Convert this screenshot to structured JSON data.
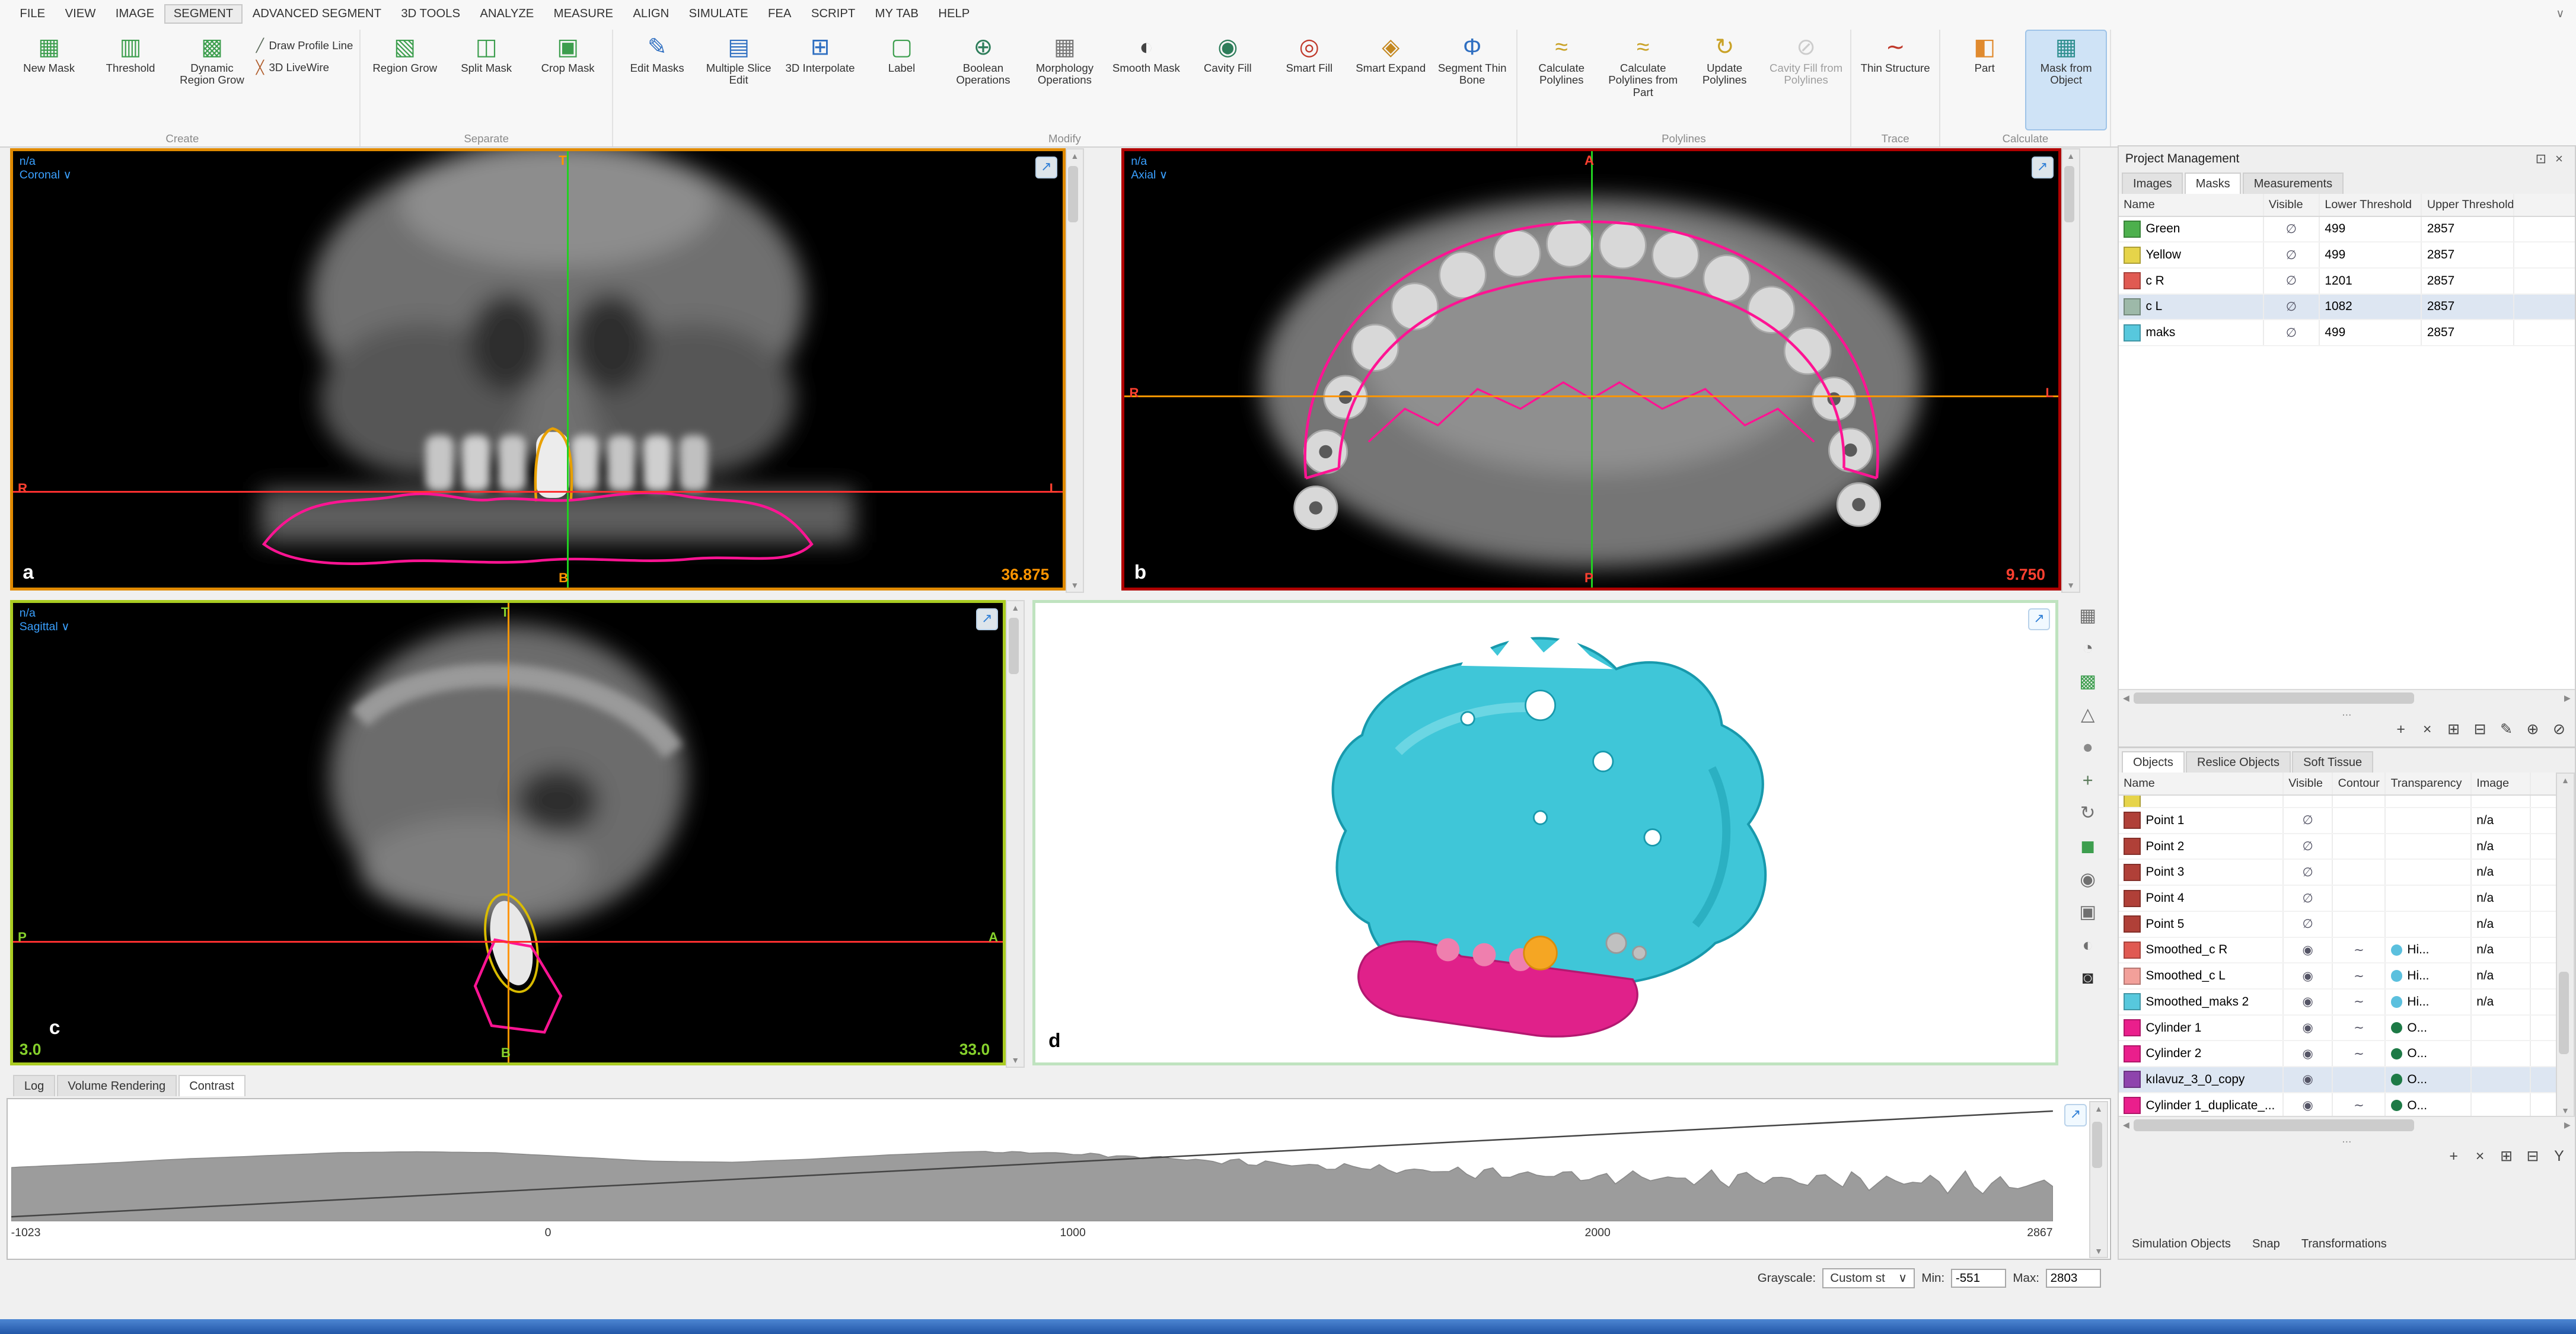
{
  "glyphs": {
    "up": "▲",
    "down": "▼",
    "left": "◀",
    "right": "▶",
    "expand": "↗",
    "caret": "∨",
    "dots": "...",
    "close": "×",
    "float": "⊡",
    "eye": "◉",
    "menu_caret": "∨"
  },
  "menu": {
    "items": [
      "FILE",
      "VIEW",
      "IMAGE",
      "SEGMENT",
      "ADVANCED SEGMENT",
      "3D TOOLS",
      "ANALYZE",
      "MEASURE",
      "ALIGN",
      "SIMULATE",
      "FEA",
      "SCRIPT",
      "MY TAB",
      "HELP"
    ],
    "active": "SEGMENT"
  },
  "ribbon": {
    "groups": [
      {
        "label": "Create",
        "buttons": [
          {
            "label": "New Mask",
            "icon": "new-mask-icon",
            "glyph": "▦",
            "color": "#3d9e4e"
          },
          {
            "label": "Threshold",
            "icon": "threshold-icon",
            "glyph": "▥",
            "color": "#3d9e4e"
          },
          {
            "label": "Dynamic Region Grow",
            "icon": "dynamic-region-grow-icon",
            "glyph": "▩",
            "color": "#3d9e4e"
          }
        ],
        "stack": [
          {
            "label": "Draw Profile Line",
            "icon": "draw-profile-line-icon",
            "glyph": "╱",
            "color": "#5a6a5a"
          },
          {
            "label": "3D LiveWire",
            "icon": "3d-livewire-icon",
            "glyph": "╳",
            "color": "#b05c2a"
          }
        ]
      },
      {
        "label": "Separate",
        "buttons": [
          {
            "label": "Region Grow",
            "icon": "region-grow-icon",
            "glyph": "▧",
            "color": "#3d9e4e"
          },
          {
            "label": "Split Mask",
            "icon": "split-mask-icon",
            "glyph": "◫",
            "color": "#3d9e4e"
          },
          {
            "label": "Crop Mask",
            "icon": "crop-mask-icon",
            "glyph": "▣",
            "color": "#3d9e4e"
          }
        ]
      },
      {
        "label": "Modify",
        "buttons": [
          {
            "label": "Edit Masks",
            "icon": "edit-masks-icon",
            "glyph": "✎",
            "color": "#2f6fc1"
          },
          {
            "label": "Multiple Slice Edit",
            "icon": "multiple-slice-edit-icon",
            "glyph": "▤",
            "color": "#2f6fc1"
          },
          {
            "label": "3D Interpolate",
            "icon": "3d-interpolate-icon",
            "glyph": "⊞",
            "color": "#2f6fc1"
          },
          {
            "label": "Label",
            "icon": "label-icon",
            "glyph": "▢",
            "color": "#3d9e4e"
          },
          {
            "label": "Boolean Operations",
            "icon": "boolean-operations-icon",
            "glyph": "⊕",
            "color": "#2d7d5a"
          },
          {
            "label": "Morphology Operations",
            "icon": "morphology-operations-icon",
            "glyph": "▦",
            "color": "#777777"
          },
          {
            "label": "Smooth Mask",
            "icon": "smooth-mask-icon",
            "glyph": "◐",
            "color": "#444444"
          },
          {
            "label": "Cavity Fill",
            "icon": "cavity-fill-icon",
            "glyph": "◉",
            "color": "#2d7d5a"
          },
          {
            "label": "Smart Fill",
            "icon": "smart-fill-icon",
            "glyph": "◎",
            "color": "#c0392b"
          },
          {
            "label": "Smart Expand",
            "icon": "smart-expand-icon",
            "glyph": "◈",
            "color": "#c48820"
          },
          {
            "label": "Segment Thin Bone",
            "icon": "segment-thin-bone-icon",
            "glyph": "Φ",
            "color": "#2f6fc1"
          }
        ]
      },
      {
        "label": "Polylines",
        "buttons": [
          {
            "label": "Calculate Polylines",
            "icon": "calculate-polylines-icon",
            "glyph": "≈",
            "color": "#c9a227"
          },
          {
            "label": "Calculate Polylines from Part",
            "icon": "calculate-polylines-from-part-icon",
            "glyph": "≈",
            "color": "#c9a227"
          },
          {
            "label": "Update Polylines",
            "icon": "update-polylines-icon",
            "glyph": "↻",
            "color": "#c9a227"
          },
          {
            "label": "Cavity Fill from Polylines",
            "icon": "cavity-fill-from-polylines-icon",
            "glyph": "⊘",
            "color": "#9a9a9a",
            "disabled": true
          }
        ]
      },
      {
        "label": "Trace",
        "buttons": [
          {
            "label": "Thin Structure",
            "icon": "thin-structure-icon",
            "glyph": "∼",
            "color": "#c0392b"
          }
        ]
      },
      {
        "label": "Calculate",
        "buttons": [
          {
            "label": "Part",
            "icon": "part-icon",
            "glyph": "◧",
            "color": "#e08a2e"
          },
          {
            "label": "Mask from Object",
            "icon": "mask-from-object-icon",
            "glyph": "▦",
            "color": "#2f8f8f",
            "selected": true
          }
        ]
      }
    ]
  },
  "side_toolbar": {
    "icons": [
      {
        "name": "layout-grid-icon",
        "glyph": "▦",
        "color": "#707070"
      },
      {
        "name": "zoom-view-icon",
        "glyph": "◔",
        "color": "#707070"
      },
      {
        "name": "mask-overlay-icon",
        "glyph": "▩",
        "color": "#3d9e4e"
      },
      {
        "name": "annotation-icon",
        "glyph": "△",
        "color": "#707070"
      },
      {
        "name": "sphere-tool-icon",
        "glyph": "●",
        "color": "#8a8a8a"
      },
      {
        "name": "pan-tool-icon",
        "glyph": "+",
        "color": "#5a7a5a"
      },
      {
        "name": "rotate-tool-icon",
        "glyph": "↻",
        "color": "#707070"
      },
      {
        "name": "cube-view-icon",
        "glyph": "◼",
        "color": "#3d9e4e"
      },
      {
        "name": "visibility-icon",
        "glyph": "◉",
        "color": "#707070"
      },
      {
        "name": "camera-icon",
        "glyph": "▣",
        "color": "#707070"
      },
      {
        "name": "contrast-icon",
        "glyph": "◐",
        "color": "#707070"
      },
      {
        "name": "screenshot-icon",
        "glyph": "◙",
        "color": "#303030"
      }
    ]
  },
  "viewports": {
    "a": {
      "na_label": "n/a",
      "view_label": "Coronal",
      "letter": "a",
      "slice_value": "36.875",
      "orient": {
        "top": "T",
        "bottom": "B",
        "left": "R",
        "right": "L"
      }
    },
    "b": {
      "na_label": "n/a",
      "view_label": "Axial",
      "letter": "b",
      "slice_value": "9.750",
      "orient": {
        "top": "A",
        "bottom": "P",
        "left": "R",
        "right": "L"
      }
    },
    "c": {
      "na_label": "n/a",
      "view_label": "Sagittal",
      "letter": "c",
      "slice_value_left": "3.0",
      "slice_value_right": "33.0",
      "orient": {
        "top": "T",
        "bottom": "B",
        "left": "P",
        "right": "A"
      }
    },
    "d": {
      "letter": "d"
    }
  },
  "project_panel": {
    "title": "Project Management",
    "tabs": [
      "Images",
      "Masks",
      "Measurements"
    ],
    "active_tab": "Masks",
    "columns": [
      "Name",
      "Visible",
      "Lower Threshold",
      "Upper Threshold"
    ],
    "rows": [
      {
        "name": "Green",
        "color": "#4db04d",
        "visible": "∅",
        "lower": "499",
        "upper": "2857"
      },
      {
        "name": "Yellow",
        "color": "#e6d44a",
        "visible": "∅",
        "lower": "499",
        "upper": "2857"
      },
      {
        "name": "c R",
        "color": "#e05a52",
        "visible": "∅",
        "lower": "1201",
        "upper": "2857"
      },
      {
        "name": "c L",
        "color": "#9db9a9",
        "visible": "∅",
        "lower": "1082",
        "upper": "2857",
        "selected": true
      },
      {
        "name": "maks",
        "color": "#57c8dd",
        "visible": "∅",
        "lower": "499",
        "upper": "2857"
      }
    ],
    "toolbar": [
      {
        "name": "add-mask-button",
        "glyph": "+"
      },
      {
        "name": "delete-mask-button",
        "glyph": "×"
      },
      {
        "name": "mask-properties-button",
        "glyph": "⊞"
      },
      {
        "name": "duplicate-mask-button",
        "glyph": "⊟"
      },
      {
        "name": "edit-mask-button",
        "glyph": "✎"
      },
      {
        "name": "boolean-mask-button",
        "glyph": "⊕"
      },
      {
        "name": "invert-mask-button",
        "glyph": "⊘"
      }
    ]
  },
  "objects_panel": {
    "tabs": [
      "Objects",
      "Reslice Objects",
      "Soft Tissue"
    ],
    "active_tab": "Objects",
    "columns": [
      "Name",
      "Visible",
      "Contour",
      "Transparency",
      "Image"
    ],
    "rows": [
      {
        "name": "",
        "color": "#e6d44a",
        "visible": "",
        "contour": "",
        "transp_text": "",
        "transp_color": "",
        "image": "",
        "partial": true
      },
      {
        "name": "Point 1",
        "color": "#b04038",
        "visible": "∅",
        "contour": "",
        "transp_text": "",
        "transp_color": "",
        "image": "n/a"
      },
      {
        "name": "Point 2",
        "color": "#b04038",
        "visible": "∅",
        "contour": "",
        "transp_text": "",
        "transp_color": "",
        "image": "n/a"
      },
      {
        "name": "Point 3",
        "color": "#b04038",
        "visible": "∅",
        "contour": "",
        "transp_text": "",
        "transp_color": "",
        "image": "n/a"
      },
      {
        "name": "Point 4",
        "color": "#b04038",
        "visible": "∅",
        "contour": "",
        "transp_text": "",
        "transp_color": "",
        "image": "n/a"
      },
      {
        "name": "Point 5",
        "color": "#b04038",
        "visible": "∅",
        "contour": "",
        "transp_text": "",
        "transp_color": "",
        "image": "n/a"
      },
      {
        "name": "Smoothed_c R",
        "color": "#e05a52",
        "visible": "eye",
        "contour": "∼",
        "transp_text": "Hi...",
        "transp_color": "#5bc0de",
        "image": "n/a"
      },
      {
        "name": "Smoothed_c L",
        "color": "#f2a09a",
        "visible": "eye",
        "contour": "∼",
        "transp_text": "Hi...",
        "transp_color": "#5bc0de",
        "image": "n/a"
      },
      {
        "name": "Smoothed_maks 2",
        "color": "#57c8dd",
        "visible": "eye",
        "contour": "∼",
        "transp_text": "Hi...",
        "transp_color": "#5bc0de",
        "image": "n/a"
      },
      {
        "name": "Cylinder 1",
        "color": "#ea1f8c",
        "visible": "eye",
        "contour": "∼",
        "transp_text": "O...",
        "transp_color": "#1d7a46",
        "image": ""
      },
      {
        "name": "Cylinder 2",
        "color": "#ea1f8c",
        "visible": "eye",
        "contour": "∼",
        "transp_text": "O...",
        "transp_color": "#1d7a46",
        "image": ""
      },
      {
        "name": "kılavuz_3_0_copy",
        "color": "#8e44ad",
        "visible": "eye",
        "contour": "",
        "transp_text": "O...",
        "transp_color": "#1d7a46",
        "image": "",
        "selected": true
      },
      {
        "name": "Cylinder 1_duplicate_...",
        "color": "#ea1f8c",
        "visible": "eye",
        "contour": "∼",
        "transp_text": "O...",
        "transp_color": "#1d7a46",
        "image": ""
      }
    ],
    "toolbar": [
      {
        "name": "add-object-button",
        "glyph": "+"
      },
      {
        "name": "delete-object-button",
        "glyph": "×"
      },
      {
        "name": "object-properties-button",
        "glyph": "⊞"
      },
      {
        "name": "duplicate-object-button",
        "glyph": "⊟"
      },
      {
        "name": "merge-objects-button",
        "glyph": "Y"
      }
    ],
    "bottom_tabs": [
      "Simulation Objects",
      "Snap",
      "Transformations"
    ]
  },
  "bottom_panel": {
    "tabs": [
      "Log",
      "Volume Rendering",
      "Contrast"
    ],
    "active": "Contrast",
    "grayscale": {
      "label": "Grayscale:",
      "mode": "Custom st",
      "min_label": "Min:",
      "min_value": "-551",
      "max_label": "Max:",
      "max_value": "2803"
    }
  },
  "chart_data": {
    "type": "area",
    "title": "Contrast grayscale histogram",
    "x": [
      -1023,
      -850,
      -700,
      -550,
      -400,
      -250,
      -100,
      50,
      200,
      350,
      500,
      650,
      800,
      950,
      1100,
      1250,
      1400,
      1550,
      1700,
      1850,
      2000,
      2150,
      2300,
      2450,
      2600,
      2750,
      2867
    ],
    "values": [
      0.48,
      0.52,
      0.56,
      0.59,
      0.62,
      0.63,
      0.62,
      0.58,
      0.54,
      0.53,
      0.56,
      0.6,
      0.63,
      0.62,
      0.59,
      0.55,
      0.51,
      0.47,
      0.44,
      0.42,
      0.4,
      0.38,
      0.37,
      0.35,
      0.34,
      0.33,
      0.3
    ],
    "xticks": [
      "-1023",
      "0",
      "1000",
      "2000",
      "2867"
    ],
    "xtick_values": [
      -1023,
      0,
      1000,
      2000,
      2867
    ],
    "xlim": [
      -1023,
      2867
    ],
    "grid": false,
    "legend": false,
    "contrast_line": {
      "x1": -1023,
      "y1": 0.04,
      "x2": 2867,
      "y2": 0.93
    }
  }
}
